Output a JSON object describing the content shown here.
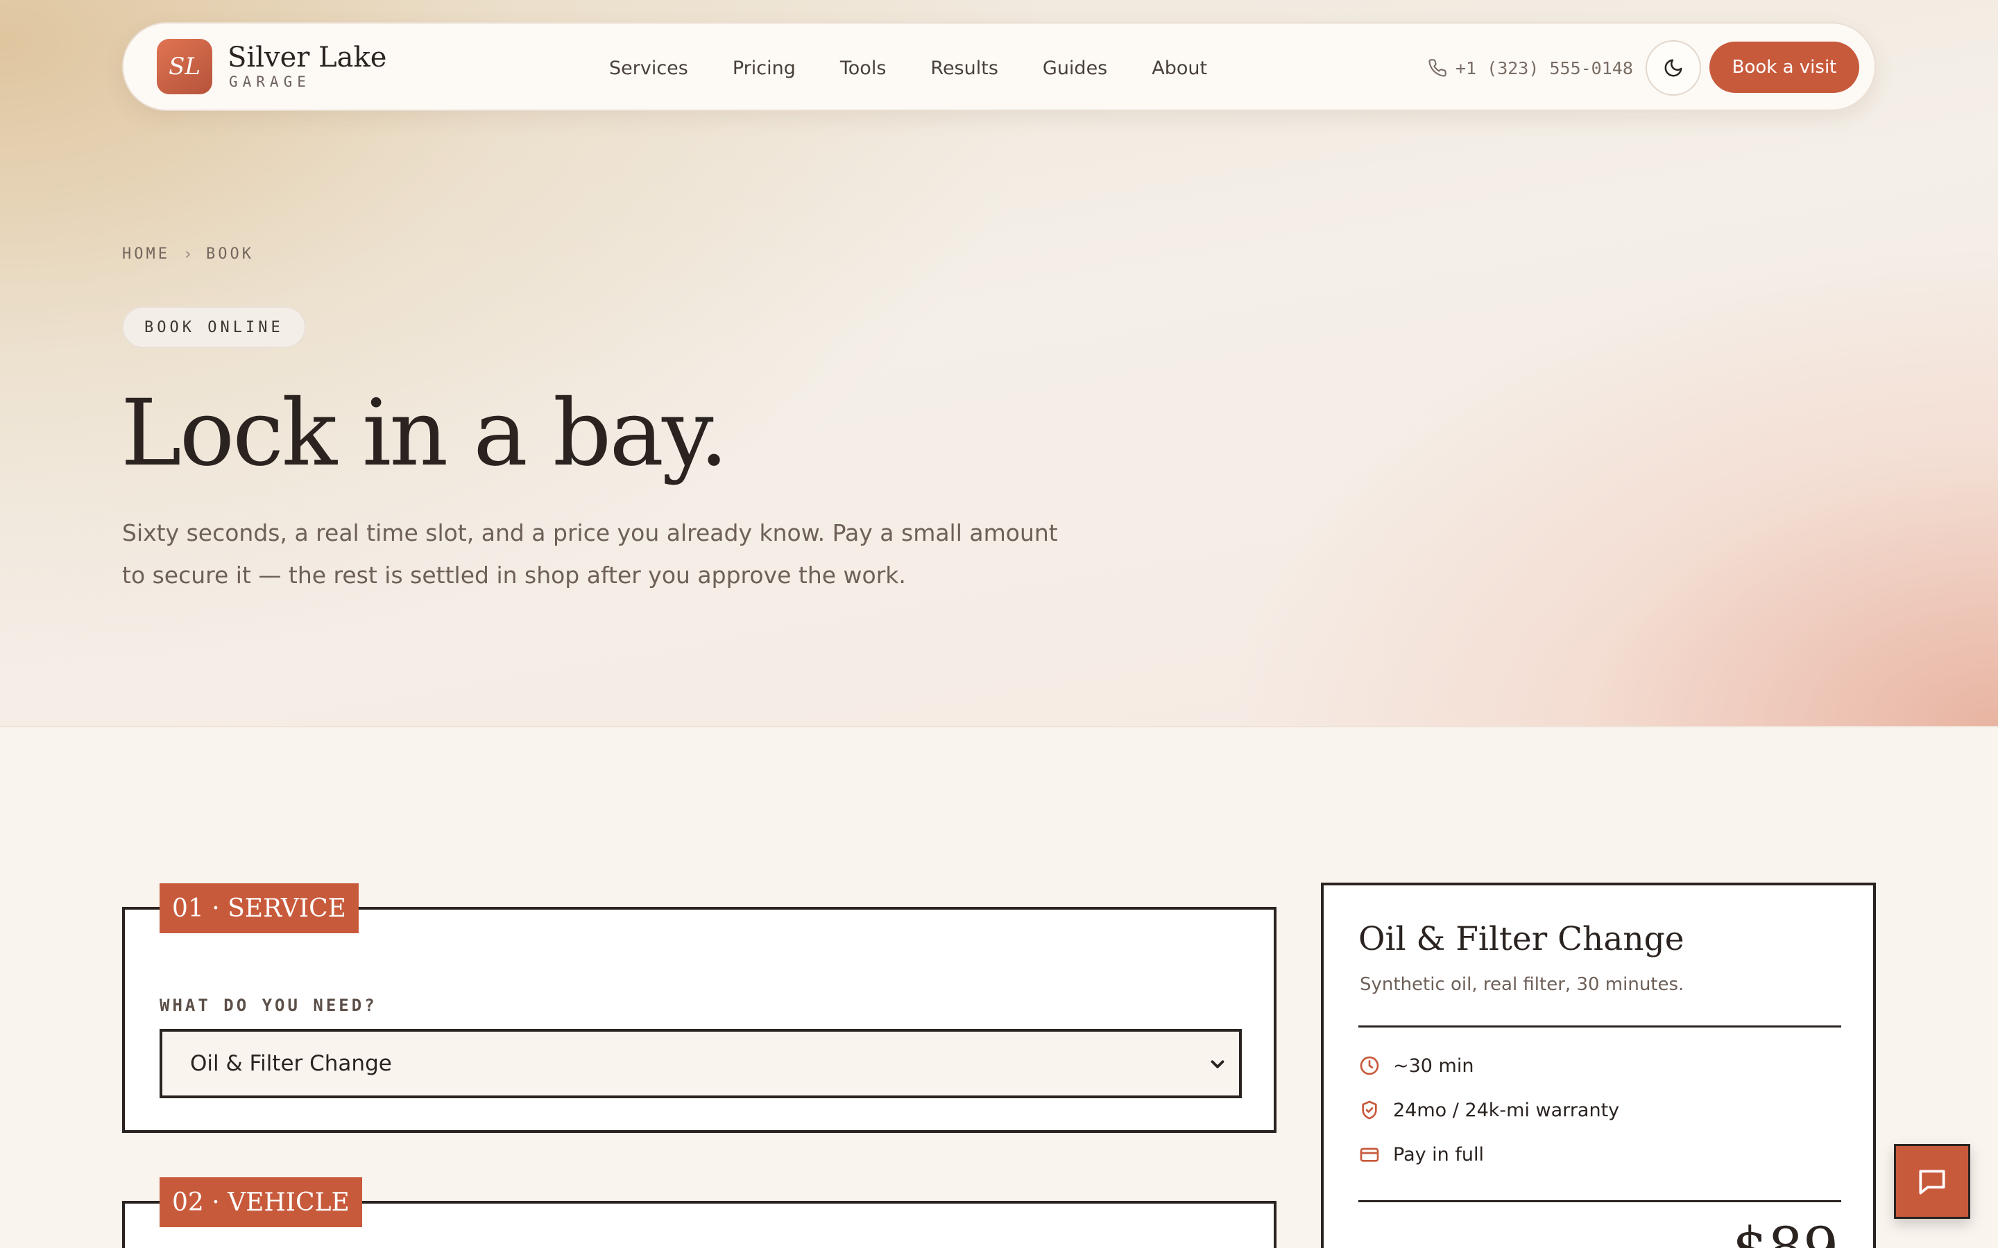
{
  "brand": {
    "mark": "SL",
    "name": "Silver Lake",
    "sub": "GARAGE",
    "accent": "#c85a3c"
  },
  "nav": {
    "links": [
      "Services",
      "Pricing",
      "Tools",
      "Results",
      "Guides",
      "About"
    ],
    "phone": "+1 (323) 555-0148",
    "theme_icon": "moon-icon",
    "cta": "Book a visit"
  },
  "breadcrumb": [
    "HOME",
    "BOOK"
  ],
  "hero": {
    "pill": "BOOK ONLINE",
    "title": "Lock in a bay.",
    "subtitle": "Sixty seconds, a real time slot, and a price you already know. Pay a small amount to secure it — the rest is settled in shop after you approve the work."
  },
  "sections": {
    "service": {
      "tag": "01 · SERVICE",
      "label": "WHAT DO YOU NEED?",
      "selected": "Oil & Filter Change"
    },
    "vehicle": {
      "tag": "02 · VEHICLE"
    }
  },
  "summary": {
    "title": "Oil & Filter Change",
    "subtitle": "Synthetic oil, real filter, 30 minutes.",
    "features": [
      {
        "icon": "clock-icon",
        "text": "~30 min"
      },
      {
        "icon": "shield-check-icon",
        "text": "24mo / 24k-mi warranty"
      },
      {
        "icon": "credit-card-icon",
        "text": "Pay in full"
      }
    ],
    "price": "$89"
  },
  "chat": {
    "icon": "chat-bubble-icon"
  }
}
